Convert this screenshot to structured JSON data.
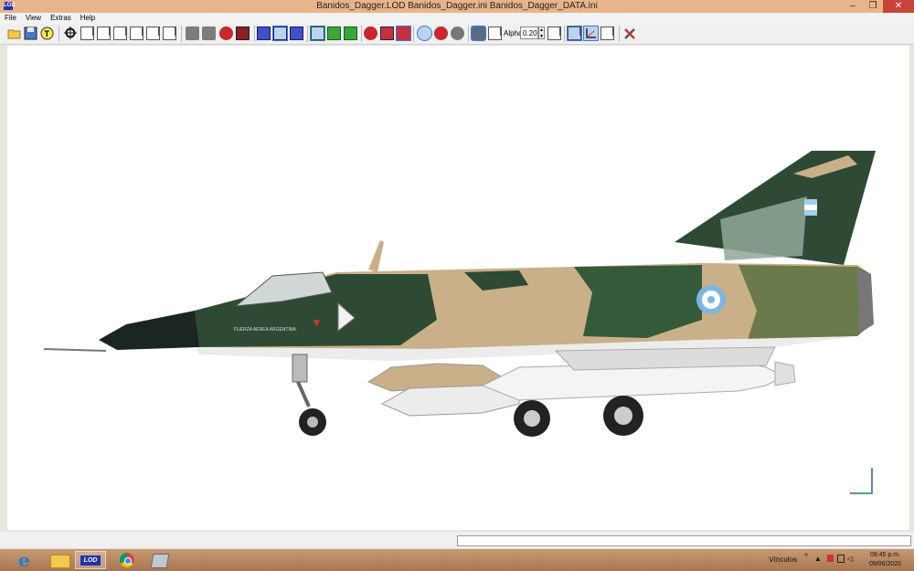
{
  "window": {
    "title": "Banidos_Dagger.LOD  Banidos_Dagger.ini  Banidos_Dagger_DATA.ini",
    "app_icon_text": "LOD"
  },
  "menu": [
    "File",
    "View",
    "Extras",
    "Help"
  ],
  "toolbar": {
    "alpha_label": "Alpha:",
    "alpha_value": "0.20"
  },
  "aircraft": {
    "fuselage_text": "FUERZA AEREA ARGENTINA",
    "colors": {
      "sky": "#ffffff",
      "tan": "#c9b088",
      "dark_green": "#2e4a34",
      "olive": "#6b7a4a",
      "white": "#ececec",
      "nose": "#1c2620",
      "roundel_blue": "#7eb6e0"
    }
  },
  "taskbar": {
    "apps": [
      "internet-explorer-icon",
      "file-explorer-icon",
      "lod-viewer-icon",
      "chrome-icon",
      "editor-icon"
    ],
    "tray_label": "Vínculos",
    "time": "09:45 p.m.",
    "date": "09/06/2020"
  }
}
